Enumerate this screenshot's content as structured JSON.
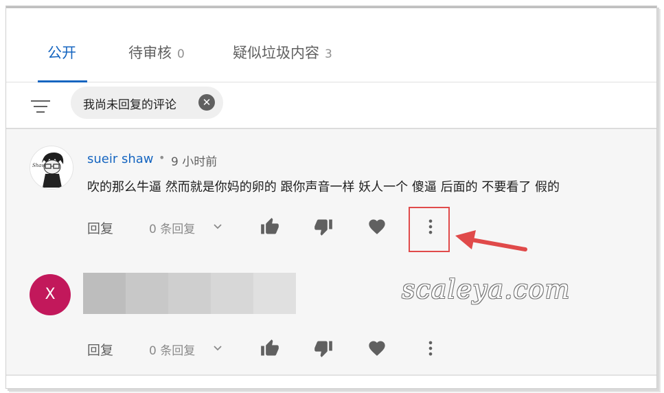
{
  "tabs": [
    {
      "label": "公开",
      "count": ""
    },
    {
      "label": "待审核",
      "count": "0"
    },
    {
      "label": "疑似垃圾内容",
      "count": "3"
    }
  ],
  "filter": {
    "chip_label": "我尚未回复的评论",
    "chip_close": "✕"
  },
  "comments": [
    {
      "author": "sueir shaw",
      "separator": "•",
      "time": "9 小时前",
      "text": "吹的那么牛逼  然而就是你妈的卵的  跟你声音一样  妖人一个  傻逼  后面的  不要看了  假的",
      "reply_label": "回复",
      "reply_count": "0 条回复",
      "avatar_icon": "cartoon-avatar"
    },
    {
      "avatar_letter": "X",
      "avatar_color": "#c2185b",
      "reply_label": "回复",
      "reply_count": "0 条回复"
    }
  ],
  "watermark": "scaleya.com",
  "colors": {
    "accent": "#1565c0",
    "highlight": "#e04a4a",
    "icon": "#606060"
  }
}
